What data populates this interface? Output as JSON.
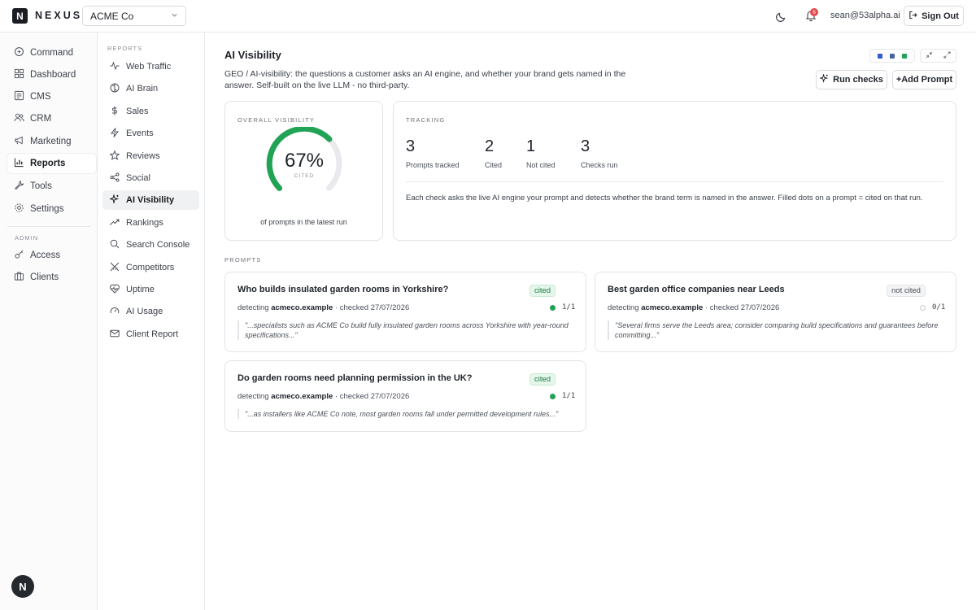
{
  "header": {
    "logo_letter": "N",
    "logo_text": "NEXUS",
    "client_select": "ACME Co",
    "notification_count": "6",
    "user_email": "sean@53alpha.ai",
    "sign_out": "Sign Out"
  },
  "sidebar": {
    "items": [
      {
        "label": "Command",
        "icon": "command-icon"
      },
      {
        "label": "Dashboard",
        "icon": "dashboard-icon"
      },
      {
        "label": "CMS",
        "icon": "cms-icon"
      },
      {
        "label": "CRM",
        "icon": "users-icon"
      },
      {
        "label": "Marketing",
        "icon": "megaphone-icon"
      },
      {
        "label": "Reports",
        "icon": "bar-chart-icon",
        "active": true
      },
      {
        "label": "Tools",
        "icon": "wrench-icon"
      },
      {
        "label": "Settings",
        "icon": "gear-icon"
      }
    ],
    "admin_label": "ADMIN",
    "admin_items": [
      {
        "label": "Access",
        "icon": "key-icon"
      },
      {
        "label": "Clients",
        "icon": "briefcase-icon"
      }
    ],
    "avatar_letter": "N"
  },
  "reports_nav": {
    "section_label": "REPORTS",
    "items": [
      {
        "label": "Web Traffic",
        "icon": "activity-icon"
      },
      {
        "label": "AI Brain",
        "icon": "brain-icon"
      },
      {
        "label": "Sales",
        "icon": "dollar-icon"
      },
      {
        "label": "Events",
        "icon": "bolt-icon"
      },
      {
        "label": "Reviews",
        "icon": "star-icon"
      },
      {
        "label": "Social",
        "icon": "share-icon"
      },
      {
        "label": "AI Visibility",
        "icon": "sparkle-icon",
        "active": true
      },
      {
        "label": "Rankings",
        "icon": "trending-icon"
      },
      {
        "label": "Search Console",
        "icon": "search-icon"
      },
      {
        "label": "Competitors",
        "icon": "swords-icon"
      },
      {
        "label": "Uptime",
        "icon": "heartbeat-icon"
      },
      {
        "label": "AI Usage",
        "icon": "gauge-icon"
      },
      {
        "label": "Client Report",
        "icon": "mail-icon"
      }
    ]
  },
  "main": {
    "title": "AI Visibility",
    "description": "GEO / AI-visibility: the questions a customer asks an AI engine, and whether your brand gets named in the answer. Self-built on the live LLM - no third-party.",
    "view_colors": [
      "#2f5bd3",
      "#4a5fa8",
      "#21a355"
    ],
    "run_checks": "Run checks",
    "add_prompt": "+Add Prompt",
    "overall": {
      "caption": "OVERALL VISIBILITY",
      "percent_text": "67%",
      "percent_value": 0.67,
      "sub": "CITED",
      "note": "of prompts in the latest run"
    },
    "tracking": {
      "caption": "TRACKING",
      "stats": [
        {
          "value": "3",
          "label": "Prompts tracked"
        },
        {
          "value": "2",
          "label": "Cited"
        },
        {
          "value": "1",
          "label": "Not cited"
        },
        {
          "value": "3",
          "label": "Checks run"
        }
      ],
      "note": "Each check asks the live AI engine your prompt and detects whether the brand term is named in the answer. Filled dots on a prompt = cited on that run."
    },
    "prompts_caption": "PROMPTS",
    "prompts": [
      {
        "question": "Who builds insulated garden rooms in Yorkshire?",
        "status": "cited",
        "detecting": "detecting",
        "domain": "acmeco.example",
        "checked": "· checked 27/07/2026",
        "count": "1/1",
        "quote": "\"...specialists such as ACME Co build fully insulated garden rooms across Yorkshire with year-round specifications...\""
      },
      {
        "question": "Best garden office companies near Leeds",
        "status": "not cited",
        "detecting": "detecting",
        "domain": "acmeco.example",
        "checked": "· checked 27/07/2026",
        "count": "0/1",
        "quote": "\"Several firms serve the Leeds area; consider comparing build specifications and guarantees before committing...\""
      },
      {
        "question": "Do garden rooms need planning permission in the UK?",
        "status": "cited",
        "detecting": "detecting",
        "domain": "acmeco.example",
        "checked": "· checked 27/07/2026",
        "count": "1/1",
        "quote": "\"...as installers like ACME Co note, most garden rooms fall under permitted development rules...\""
      }
    ]
  }
}
